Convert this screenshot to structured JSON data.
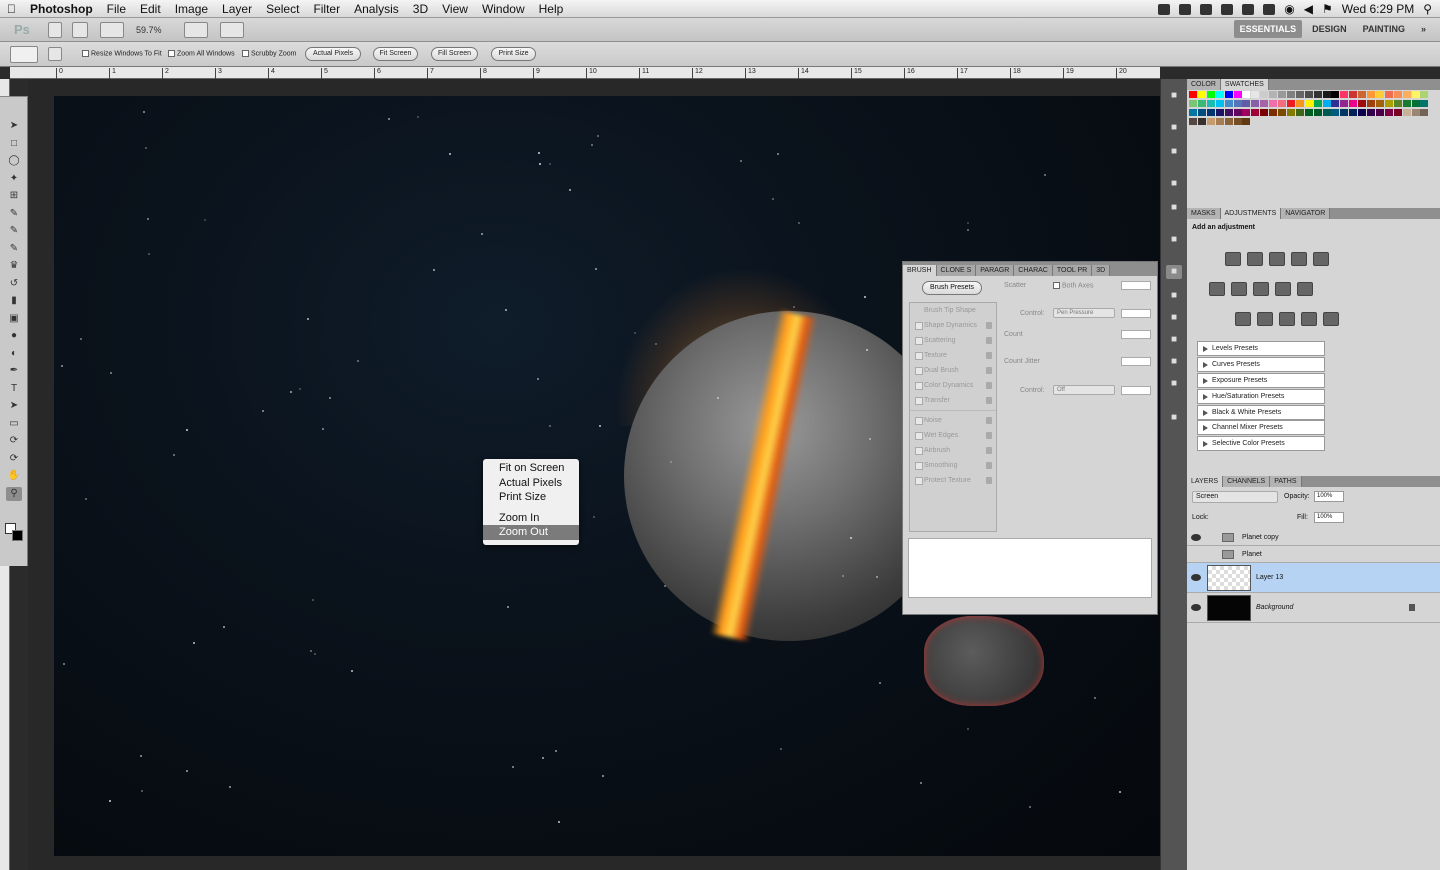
{
  "menubar": {
    "app_name": "Photoshop",
    "menus": [
      "File",
      "Edit",
      "Image",
      "Layer",
      "Select",
      "Filter",
      "Analysis",
      "3D",
      "View",
      "Window",
      "Help"
    ],
    "clock": "Wed 6:29 PM"
  },
  "appbar": {
    "zoom": "59.7%",
    "workspaces": [
      "ESSENTIALS",
      "DESIGN",
      "PAINTING"
    ]
  },
  "options": {
    "resize_windows": "Resize Windows To Fit",
    "zoom_all": "Zoom All Windows",
    "scrubby_zoom": "Scrubby Zoom",
    "actual_pixels": "Actual Pixels",
    "fit_screen": "Fit Screen",
    "fill_screen": "Fill Screen",
    "print_size": "Print Size"
  },
  "ruler": [
    "0",
    "1",
    "2",
    "3",
    "4",
    "5",
    "6",
    "7",
    "8",
    "9",
    "10",
    "11",
    "12",
    "13",
    "14",
    "15",
    "16",
    "17",
    "18",
    "19",
    "20"
  ],
  "context_menu": {
    "items": [
      "Fit on Screen",
      "Actual Pixels",
      "Print Size",
      "Zoom In",
      "Zoom Out"
    ],
    "selected": "Zoom Out"
  },
  "brush_panel": {
    "tabs": [
      "BRUSH",
      "CLONE S",
      "PARAGR",
      "CHARAC",
      "TOOL PR",
      "3D"
    ],
    "brush_presets": "Brush Presets",
    "brush_tip_shape": "Brush Tip Shape",
    "options": [
      "Shape Dynamics",
      "Scattering",
      "Texture",
      "Dual Brush",
      "Color Dynamics",
      "Transfer",
      "Noise",
      "Wet Edges",
      "Airbrush",
      "Smoothing",
      "Protect Texture"
    ],
    "scatter": "Scatter",
    "both_axes": "Both Axes",
    "control": "Control:",
    "pen_pressure": "Pen Pressure",
    "count": "Count",
    "count_jitter": "Count Jitter",
    "off": "Off"
  },
  "color_panel": {
    "tabs": [
      "COLOR",
      "SWATCHES"
    ]
  },
  "adjustments_panel": {
    "tabs": [
      "MASKS",
      "ADJUSTMENTS",
      "NAVIGATOR"
    ],
    "heading": "Add an adjustment",
    "presets": [
      "Levels Presets",
      "Curves Presets",
      "Exposure Presets",
      "Hue/Saturation Presets",
      "Black & White Presets",
      "Channel Mixer Presets",
      "Selective Color Presets"
    ]
  },
  "layers_panel": {
    "tabs": [
      "LAYERS",
      "CHANNELS",
      "PATHS"
    ],
    "blend_mode": "Screen",
    "opacity_label": "Opacity:",
    "opacity": "100%",
    "lock_label": "Lock:",
    "fill_label": "Fill:",
    "fill": "100%",
    "layers": [
      "Planet copy",
      "Planet",
      "Layer 13",
      "Background"
    ]
  },
  "colors": {
    "selection": "#b7d3f4",
    "accent": "#7b7b7b"
  }
}
